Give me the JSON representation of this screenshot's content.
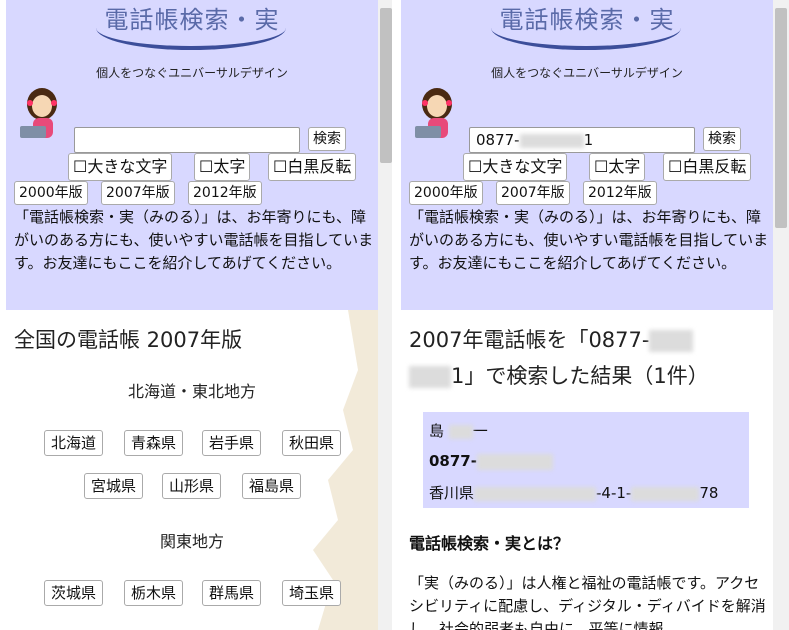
{
  "header": {
    "logo": "電話帳検索・実",
    "tagline": "個人をつなぐユニバーサルデザイン",
    "search_button": "検索",
    "large_text": "☐大きな文字",
    "bold": "☐太字",
    "invert": "☐白黒反転",
    "editions": [
      "2000年版",
      "2007年版",
      "2012年版"
    ],
    "description": "「電話帳検索・実（みのる）」は、お年寄りにも、障がいのある方にも、使いやすい電話帳を目指しています。お友達にもここを紹介してあげてください。"
  },
  "left": {
    "search_value": "",
    "section_title": "全国の電話帳 2007年版",
    "regions": [
      {
        "name": "北海道・東北地方",
        "prefs": [
          "北海道",
          "青森県",
          "岩手県",
          "秋田県",
          "宮城県",
          "山形県",
          "福島県"
        ]
      },
      {
        "name": "関東地方",
        "prefs": [
          "茨城県",
          "栃木県",
          "群馬県",
          "埼玉県"
        ]
      }
    ]
  },
  "right": {
    "search_value": "0877-",
    "search_value_tail": "1",
    "result_title_a": "2007年電話帳を「0877-",
    "result_title_b": "1」で検索した結果（1件）",
    "card": {
      "name": "島",
      "name_tail": "一",
      "phone": "0877-",
      "address_a": "香川県",
      "address_b": "-4-1-",
      "address_c": "78"
    },
    "about_title": "電話帳検索・実とは？",
    "about_text": "「実（みのる）」は人権と福祉の電話帳です。アクセシビリティに配慮し、ディジタル・ディバイドを解消し、社会的弱者も自由に、平等に情報"
  },
  "colors": {
    "header_bg": "#d8d8ff",
    "logo": "#5a6aa8",
    "arc": "#3c4e9a"
  }
}
